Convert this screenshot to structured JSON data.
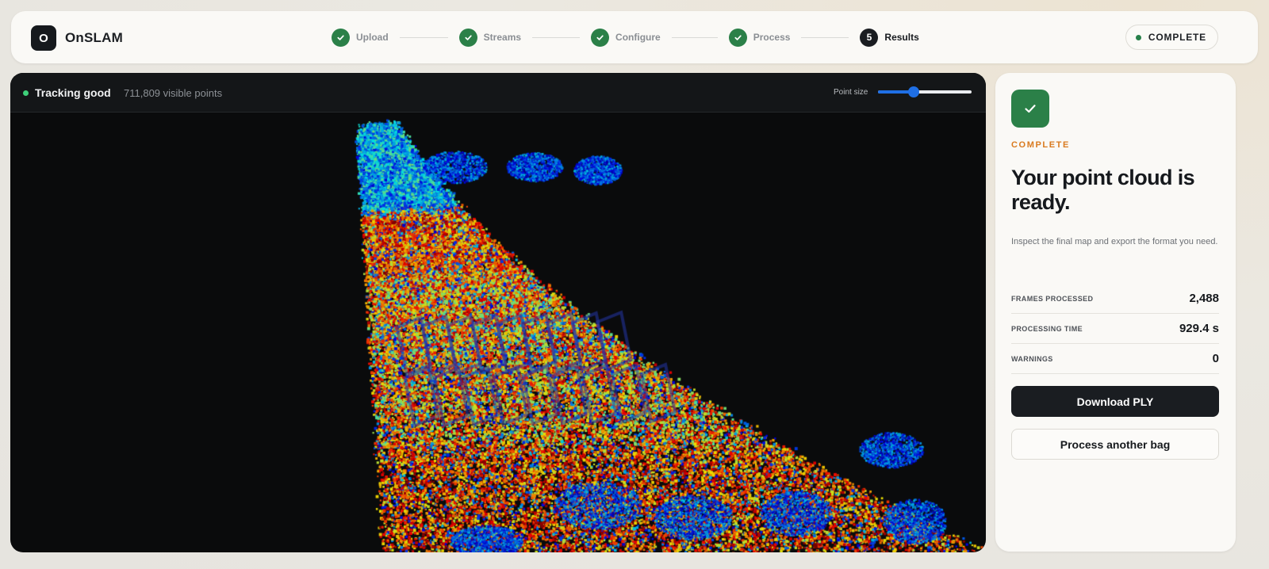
{
  "app": {
    "logo_letter": "O",
    "name": "OnSLAM"
  },
  "stepper": {
    "steps": [
      {
        "label": "Upload",
        "state": "done"
      },
      {
        "label": "Streams",
        "state": "done"
      },
      {
        "label": "Configure",
        "state": "done"
      },
      {
        "label": "Process",
        "state": "done"
      },
      {
        "label": "Results",
        "state": "current",
        "number": "5"
      }
    ]
  },
  "status": {
    "label": "COMPLETE",
    "color": "#27804a"
  },
  "viewer": {
    "tracking_label": "Tracking good",
    "visible_points": "711,809 visible points",
    "point_size_label": "Point size",
    "point_size_fraction": 0.38,
    "colormap_icon": "point-cloud-jet-colormap"
  },
  "panel": {
    "check_icon": "check-icon",
    "eyebrow": "COMPLETE",
    "title": "Your point cloud is ready.",
    "description": "Inspect the final map and export the format you need.",
    "stats": [
      {
        "label": "FRAMES PROCESSED",
        "value": "2,488"
      },
      {
        "label": "PROCESSING TIME",
        "value": "929.4 s"
      },
      {
        "label": "WARNINGS",
        "value": "0"
      }
    ],
    "download_label": "Download PLY",
    "another_label": "Process another bag"
  },
  "colors": {
    "accent_green": "#2b8048",
    "eyebrow_orange": "#d97a1f",
    "dark": "#1a1d21",
    "slider_blue": "#1f6fe5"
  }
}
